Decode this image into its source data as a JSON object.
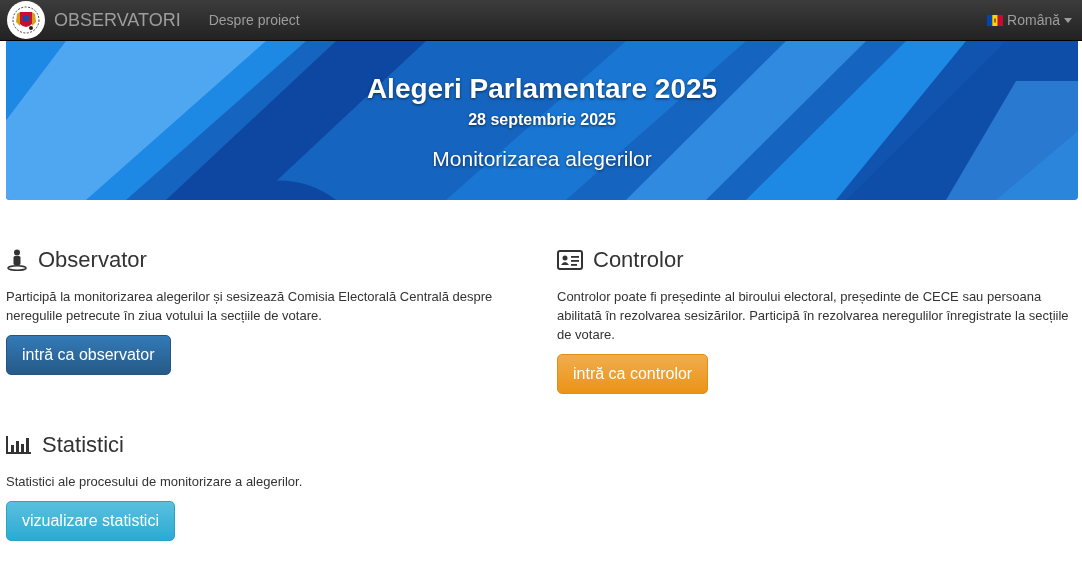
{
  "navbar": {
    "brand": "OBSERVATORI",
    "links": [
      "Despre proiect"
    ],
    "language": "Română"
  },
  "banner": {
    "title": "Alegeri Parlamentare 2025",
    "date": "28 septembrie 2025",
    "subtitle": "Monitorizarea alegerilor"
  },
  "sections": [
    {
      "kind": "observer",
      "title": "Observator",
      "description": "Participă la monitorizarea alegerilor și sesizează Comisia Electorală Centrală despre neregulile petrecute în ziua votului la secțiile de votare.",
      "button": "intră ca observator"
    },
    {
      "kind": "controller",
      "title": "Controlor",
      "description": "Controlor poate fi președinte al biroului electoral, președinte de CECE sau persoana abilitată în rezolvarea sesizărilor. Participă în rezolvarea neregulilor înregistrate la secțiile de votare.",
      "button": "intră ca controlor"
    },
    {
      "kind": "statistics",
      "title": "Statistici",
      "description": "Statistici ale procesului de monitorizare a alegerilor.",
      "button": "vizualizare statistici"
    }
  ]
}
